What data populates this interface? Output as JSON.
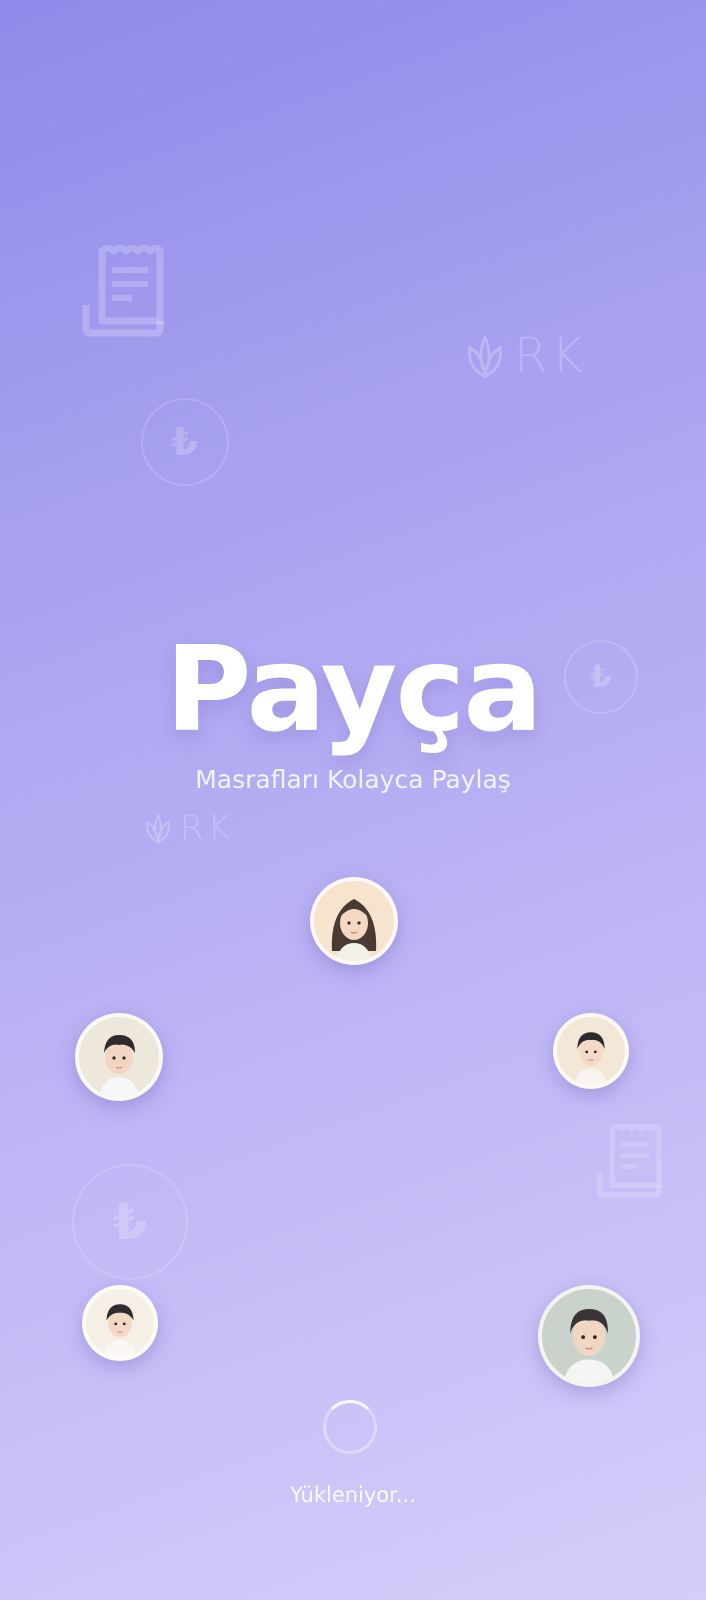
{
  "app": {
    "title": "Payça",
    "subtitle": "Masrafları Kolayca Paylaş"
  },
  "decorations": {
    "currency_symbol": "₺",
    "logo_text": "RK",
    "receipt_icon": "receipt-icon",
    "leaf_icon": "leaf-icon"
  },
  "loading": {
    "text": "Yükleniyor..."
  },
  "avatars": [
    {
      "name": "avatar-woman-long-hair"
    },
    {
      "name": "avatar-man-left"
    },
    {
      "name": "avatar-man-right"
    },
    {
      "name": "avatar-man-bottom-left"
    },
    {
      "name": "avatar-man-bottom-right"
    }
  ],
  "colors": {
    "background_start": "#8f89ea",
    "background_end": "#d6cdfa",
    "text": "#ffffff"
  }
}
